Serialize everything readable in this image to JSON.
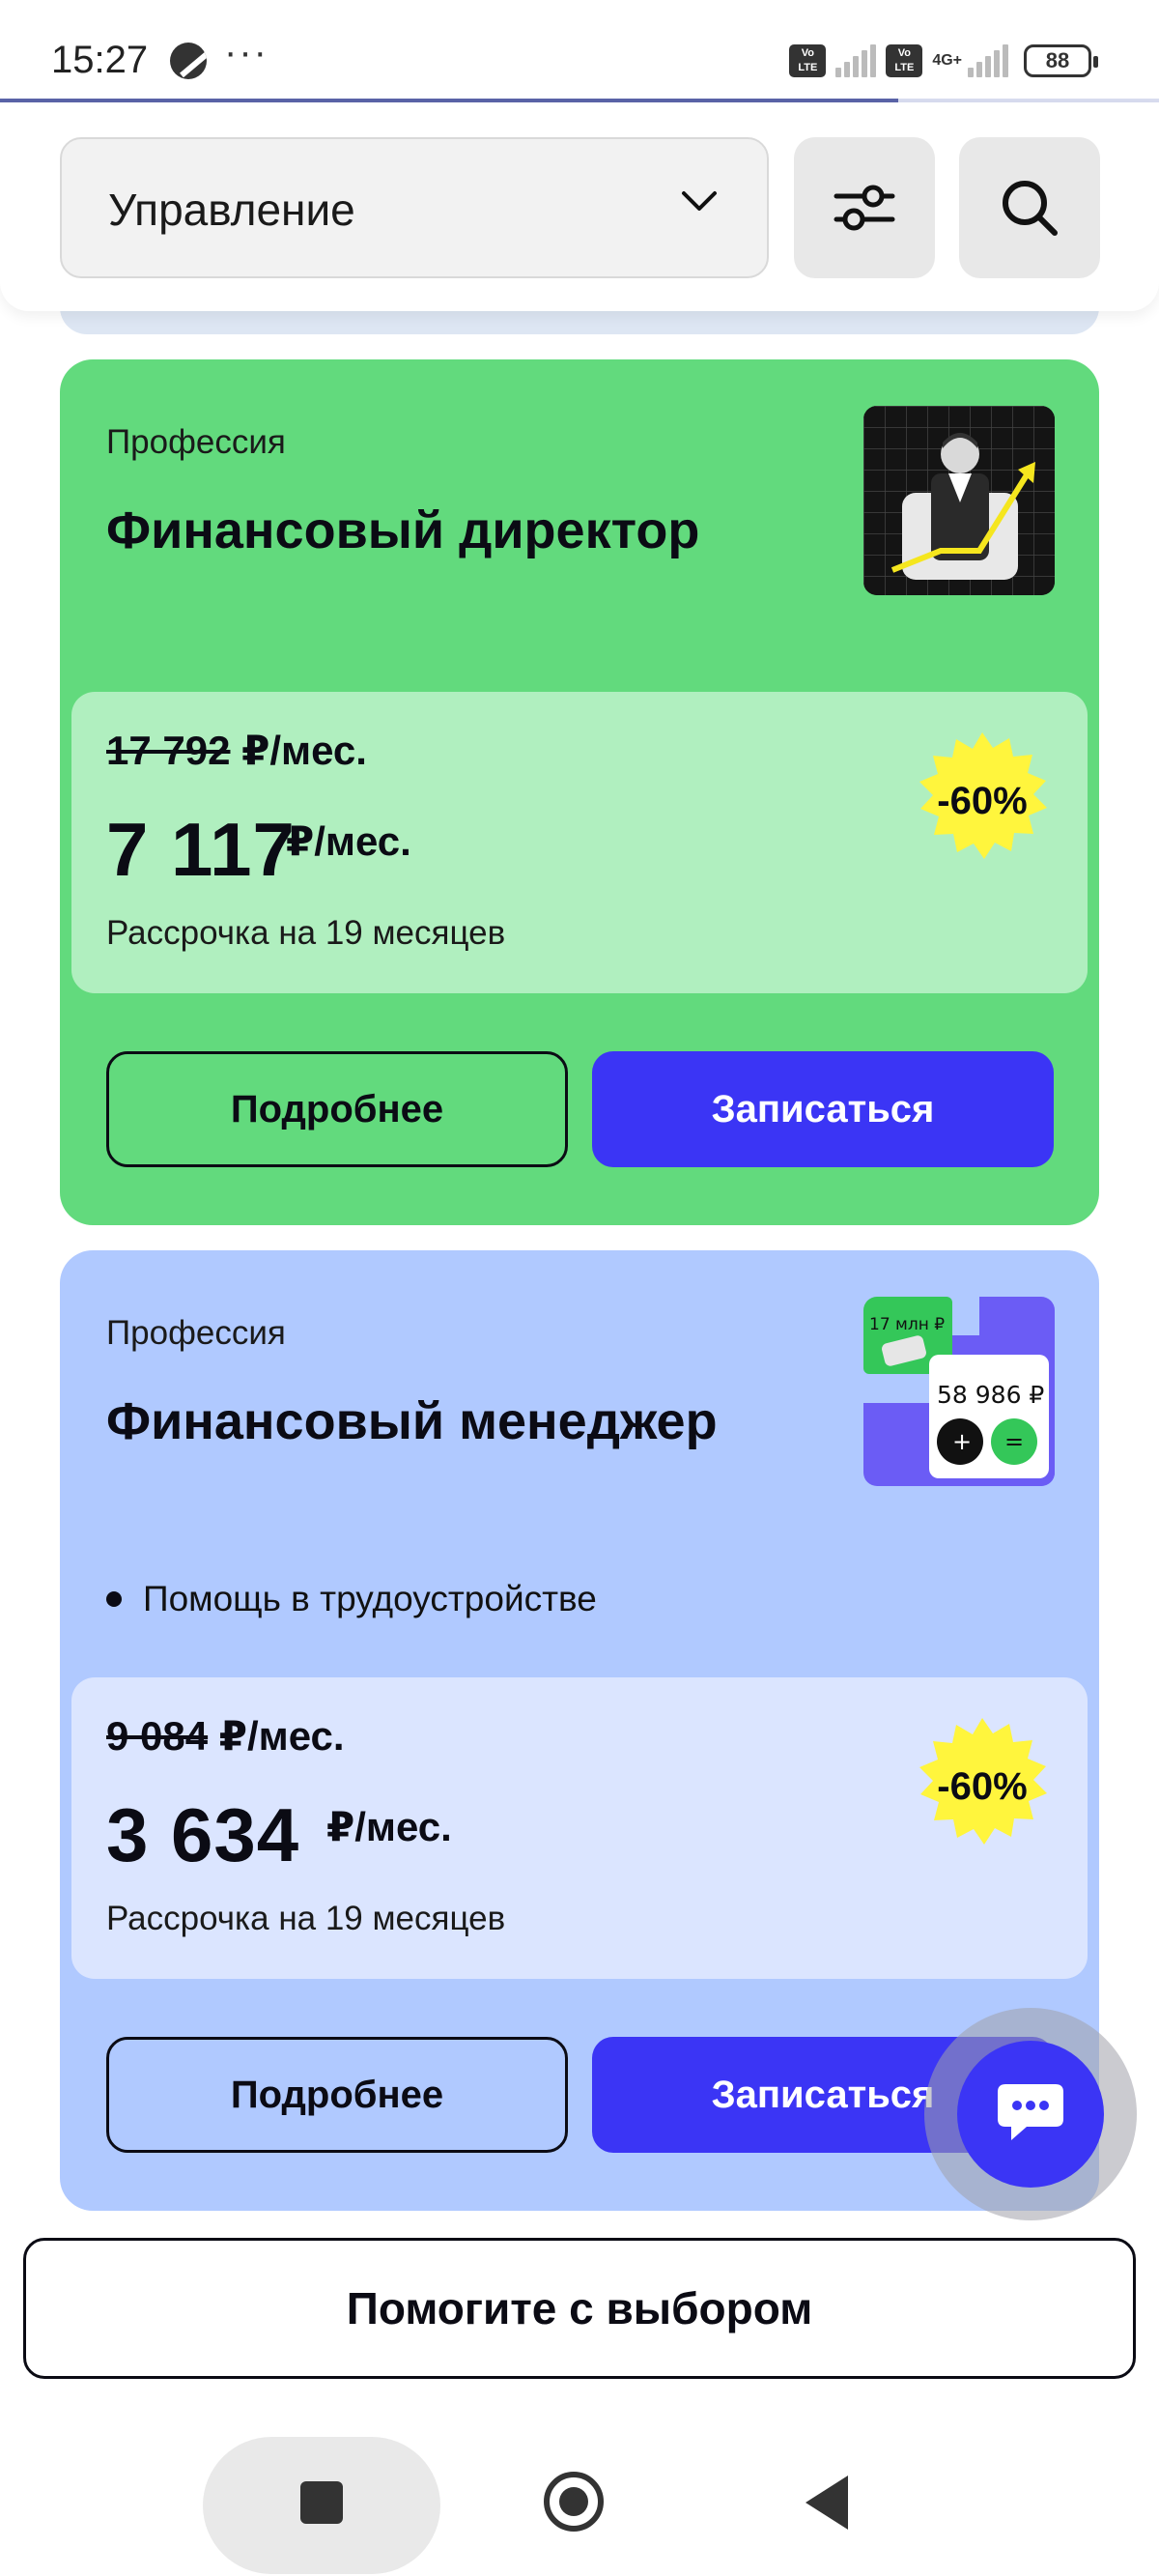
{
  "status_bar": {
    "time": "15:27",
    "more": "···",
    "volte_label": "Vo LTE",
    "network": "4G+",
    "battery": "88"
  },
  "filter_bar": {
    "category_value": "Управление",
    "filter_icon": "sliders-icon",
    "search_icon": "search-icon"
  },
  "cards": [
    {
      "type": "Профессия",
      "title": "Финансовый директор",
      "bullet": "",
      "old_price": "17 792",
      "old_price_unit": "₽/мес.",
      "price": "7 117",
      "price_unit": "₽/мес.",
      "installment": "Рассрочка на 19 месяцев",
      "discount": "-60%",
      "more_label": "Подробнее",
      "enroll_label": "Записаться"
    },
    {
      "type": "Профессия",
      "title": "Финансовый менеджер",
      "bullet": "Помощь в трудоустройстве",
      "thumb_text_1": "17 млн ₽",
      "thumb_text_2": "58 986 ₽",
      "old_price": "9 084",
      "old_price_unit": "₽/мес.",
      "price": "3 634",
      "price_unit": "₽/мес.",
      "installment": "Рассрочка на 19 месяцев",
      "discount": "-60%",
      "more_label": "Подробнее",
      "enroll_label": "Записаться"
    }
  ],
  "help_button": "Помогите с выбором",
  "colors": {
    "accent": "#3b35f5",
    "card_green": "#62da7d",
    "card_blue": "#b0c9ff",
    "badge_yellow": "#fff53d"
  }
}
